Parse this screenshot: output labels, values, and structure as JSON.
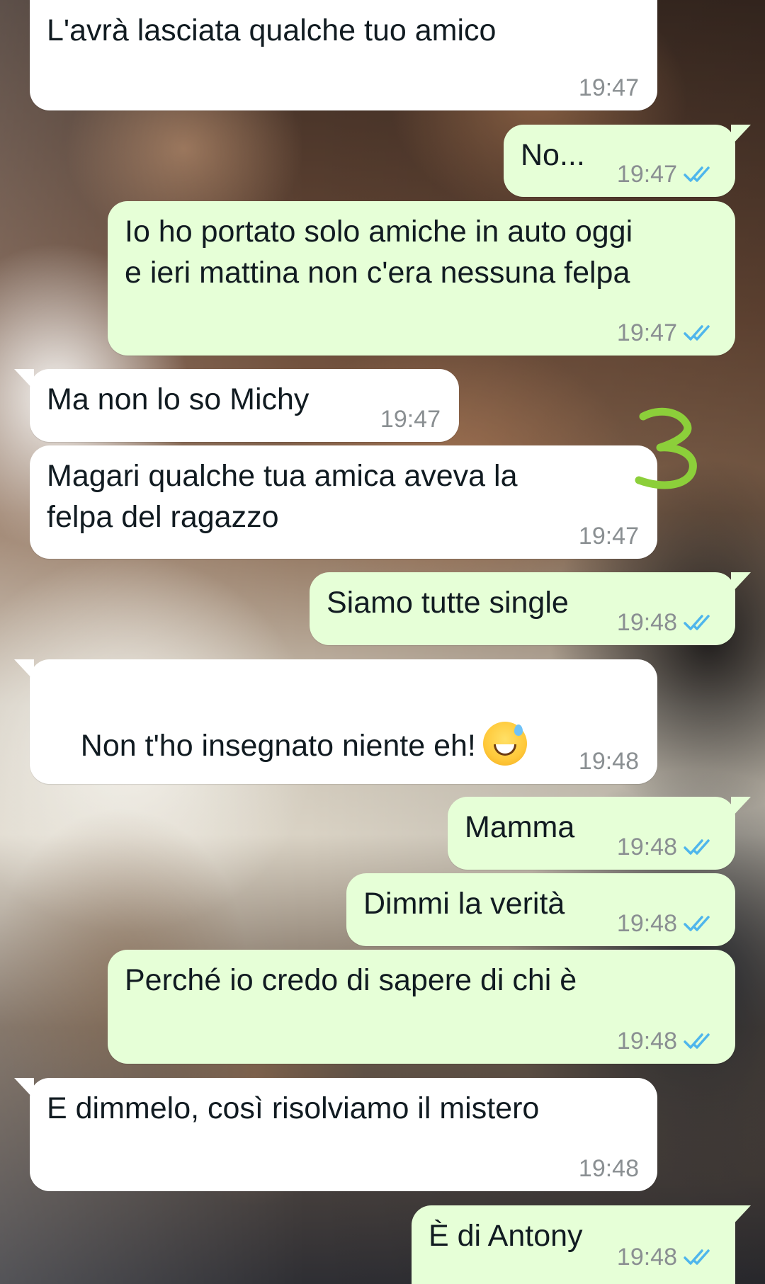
{
  "colors": {
    "incoming_bubble": "#ffffff",
    "outgoing_bubble": "#e6ffd7",
    "text": "#111b21",
    "timestamp": "#8a8f92",
    "read_ticks": "#4fb6ec",
    "doodle": "#8ccf3a"
  },
  "icons": {
    "read_receipt": "double-check-icon",
    "emoji": "grinning-face-with-sweat-emoji",
    "doodle": "hand-drawn-number-3"
  },
  "doodle": {
    "text": "3"
  },
  "messages": [
    {
      "direction": "incoming",
      "text": "L'avrà lasciata qualche tuo amico",
      "time": "19:47"
    },
    {
      "direction": "outgoing",
      "text": "No...",
      "time": "19:47"
    },
    {
      "direction": "outgoing",
      "text": "Io ho portato solo amiche in auto oggi\ne ieri mattina non c'era nessuna felpa",
      "time": "19:47"
    },
    {
      "direction": "incoming",
      "text": "Ma non lo so Michy",
      "time": "19:47"
    },
    {
      "direction": "incoming",
      "text": "Magari qualche tua amica aveva la\nfelpa del ragazzo",
      "time": "19:47"
    },
    {
      "direction": "outgoing",
      "text": "Siamo tutte single",
      "time": "19:48"
    },
    {
      "direction": "incoming",
      "text": "Non t'ho insegnato niente eh!",
      "time": "19:48"
    },
    {
      "direction": "outgoing",
      "text": "Mamma",
      "time": "19:48"
    },
    {
      "direction": "outgoing",
      "text": "Dimmi la verità",
      "time": "19:48"
    },
    {
      "direction": "outgoing",
      "text": "Perché io credo di sapere di chi è",
      "time": "19:48"
    },
    {
      "direction": "incoming",
      "text": "E dimmelo, così risolviamo il mistero",
      "time": "19:48"
    },
    {
      "direction": "outgoing",
      "text": "È di Antony",
      "time": "19:48"
    }
  ]
}
